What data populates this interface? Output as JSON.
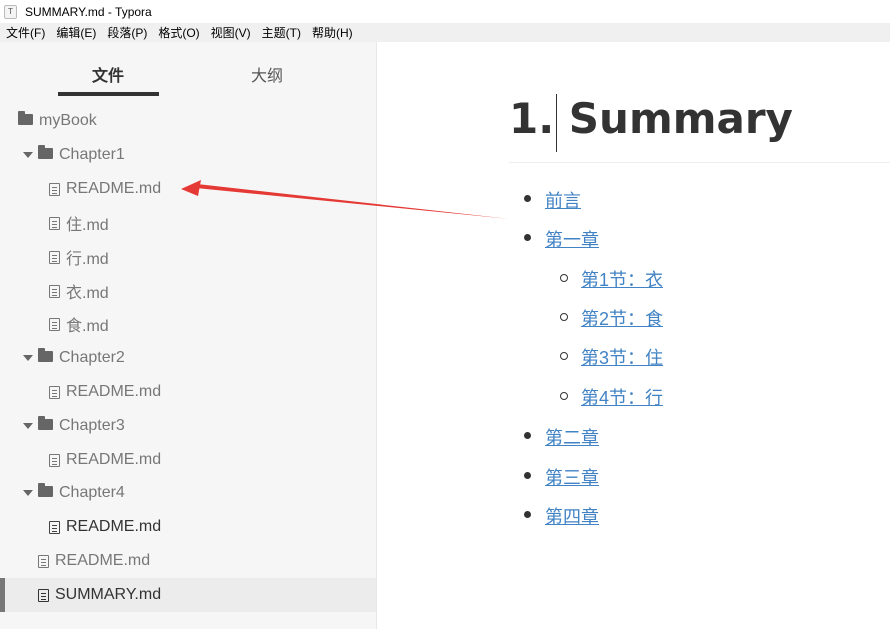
{
  "window": {
    "title": "SUMMARY.md - Typora",
    "app_icon": "typora-icon"
  },
  "menu": [
    "文件(F)",
    "编辑(E)",
    "段落(P)",
    "格式(O)",
    "视图(V)",
    "主题(T)",
    "帮助(H)"
  ],
  "sidebar": {
    "tabs": {
      "files": "文件",
      "outline": "大纲",
      "active": "files"
    },
    "tree": [
      {
        "type": "folder",
        "label": "myBook",
        "expanded": false
      },
      {
        "type": "folder",
        "label": "Chapter1",
        "expanded": true
      },
      {
        "type": "file",
        "label": "README.md"
      },
      {
        "type": "file",
        "label": "住.md"
      },
      {
        "type": "file",
        "label": "行.md"
      },
      {
        "type": "file",
        "label": "衣.md"
      },
      {
        "type": "file",
        "label": "食.md"
      },
      {
        "type": "folder",
        "label": "Chapter2",
        "expanded": true
      },
      {
        "type": "file",
        "label": "README.md"
      },
      {
        "type": "folder",
        "label": "Chapter3",
        "expanded": true
      },
      {
        "type": "file",
        "label": "README.md"
      },
      {
        "type": "folder",
        "label": "Chapter4",
        "expanded": true
      },
      {
        "type": "file",
        "label": "README.md"
      },
      {
        "type": "file",
        "label": "README.md"
      },
      {
        "type": "file",
        "label": "SUMMARY.md",
        "selected": true
      }
    ]
  },
  "editor": {
    "heading": "1. Summary",
    "toc": [
      {
        "label": "前言",
        "level": 1
      },
      {
        "label": "第一章",
        "level": 1
      },
      {
        "label": "第1节：衣",
        "level": 2
      },
      {
        "label": "第2节：食",
        "level": 2
      },
      {
        "label": "第3节：住",
        "level": 2
      },
      {
        "label": "第4节：行",
        "level": 2
      },
      {
        "label": "第二章",
        "level": 1
      },
      {
        "label": "第三章",
        "level": 1
      },
      {
        "label": "第四章",
        "level": 1
      }
    ]
  },
  "annotation": {
    "arrow_color": "#e53935"
  }
}
